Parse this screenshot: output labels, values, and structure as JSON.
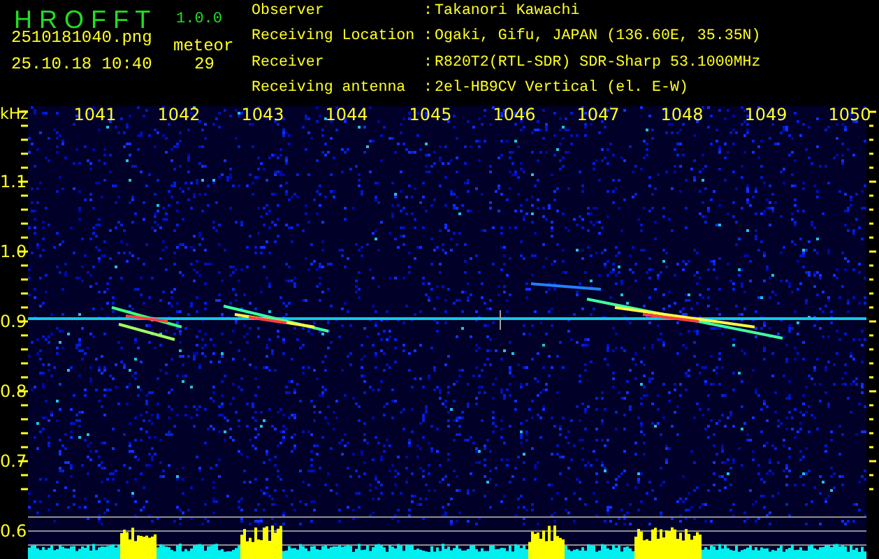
{
  "header": {
    "app_name": "H R O F F T",
    "version": "1.0.0",
    "filename": "2510181040.png",
    "datetime": "25.10.18 10:40",
    "meteor_label": "meteor",
    "meteor_count": "29"
  },
  "info": [
    {
      "label": "Observer",
      "separator": ":",
      "value": "Takanori Kawachi"
    },
    {
      "label": "Receiving Location",
      "separator": ":",
      "value": "Ogaki, Gifu, JAPAN (136.60E, 35.35N)"
    },
    {
      "label": "Receiver",
      "separator": ":",
      "value": "R820T2(RTL-SDR) SDR-Sharp 53.1000MHz"
    },
    {
      "label": "Receiving antenna",
      "separator": ":",
      "value": "2el-HB9CV Vertical (el. E-W)"
    }
  ],
  "x_axis": {
    "unit": "kHz",
    "ticks": [
      "1041",
      "1042",
      "1043",
      "1044",
      "1045",
      "1046",
      "1047",
      "1048",
      "1049",
      "1050"
    ]
  },
  "y_axis": {
    "ticks": [
      "1.1",
      "1.0",
      "0.9",
      "0.8",
      "0.7",
      "0.6"
    ]
  }
}
